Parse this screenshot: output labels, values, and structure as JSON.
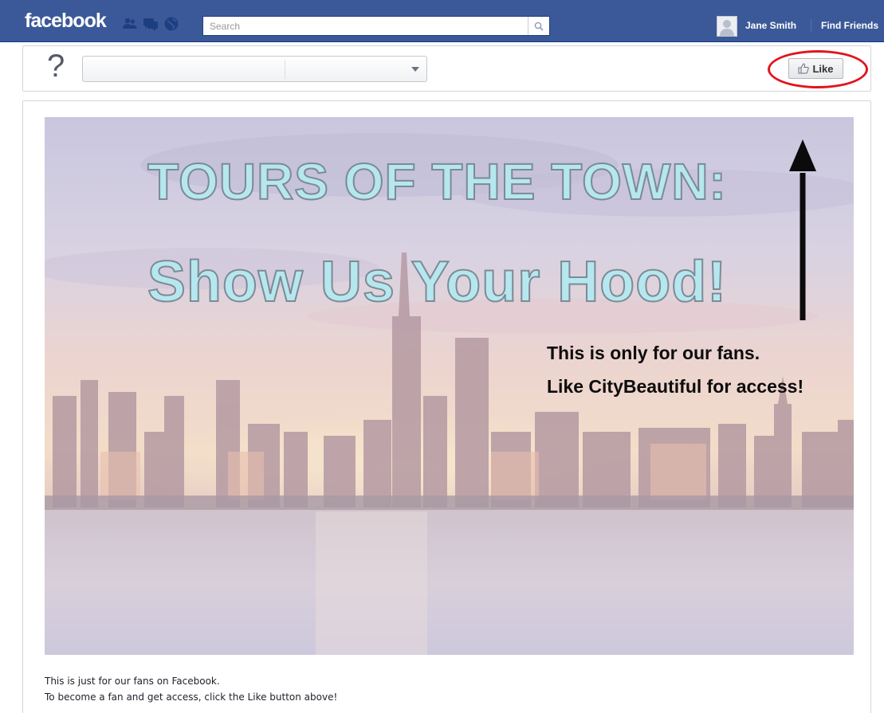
{
  "topbar": {
    "logo": "facebook",
    "search": {
      "placeholder": "Search"
    },
    "user_name": "Jane Smith",
    "find_friends": "Find Friends",
    "jewels": [
      "friend-requests-icon",
      "messages-icon",
      "notifications-icon"
    ],
    "colors": {
      "bar": "#3b5998"
    }
  },
  "page_header": {
    "icon": "question-mark-icon",
    "selector_value": "",
    "like_label": "Like",
    "highlight_color": "#e0161e"
  },
  "banner": {
    "title_line1": "TOURS OF THE TOWN:",
    "title_line2": "Show Us Your Hood!",
    "fans_line1": "This is only for our fans.",
    "fans_line2": "Like CityBeautiful for access!"
  },
  "footer": {
    "line1": "This is just for our fans on Facebook.",
    "line2": "To become a fan and get access, click the Like button above!"
  }
}
